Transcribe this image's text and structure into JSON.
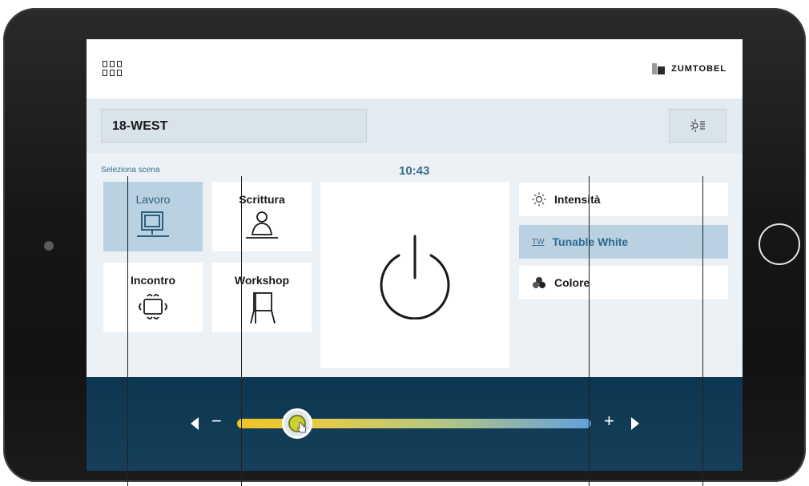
{
  "topbar": {
    "menu_icon": "apps-grid-icon",
    "brand": "ZUMTOBEL",
    "brand_icon": "zumtobel-logo-icon"
  },
  "room": {
    "name": "18-WEST",
    "settings_icon": "light-settings-icon"
  },
  "scenes": {
    "label": "Seleziona scena",
    "items": [
      {
        "name": "Lavoro",
        "icon": "monitor-desk-icon",
        "active": true
      },
      {
        "name": "Scrittura",
        "icon": "person-writing-icon",
        "active": false
      },
      {
        "name": "Incontro",
        "icon": "meeting-table-icon",
        "active": false
      },
      {
        "name": "Workshop",
        "icon": "flipchart-icon",
        "active": false
      }
    ]
  },
  "clock": {
    "time": "10:43"
  },
  "power": {
    "icon": "power-icon"
  },
  "modes": [
    {
      "label": "Intensità",
      "icon": "sun-icon",
      "active": false
    },
    {
      "label": "Tunable White",
      "icon": "tw-icon",
      "glyph": "TW",
      "active": true
    },
    {
      "label": "Colore",
      "icon": "color-palette-icon",
      "active": false
    }
  ],
  "slider": {
    "minus": "−",
    "plus": "+",
    "value_fraction": 0.17,
    "colors": {
      "warm": "#f1c21f",
      "cool": "#5d9fdc"
    }
  },
  "colors": {
    "bottom_bar": "#0b3550",
    "active_tile": "#b9d1e0",
    "accent_text": "#3a6d8c"
  }
}
